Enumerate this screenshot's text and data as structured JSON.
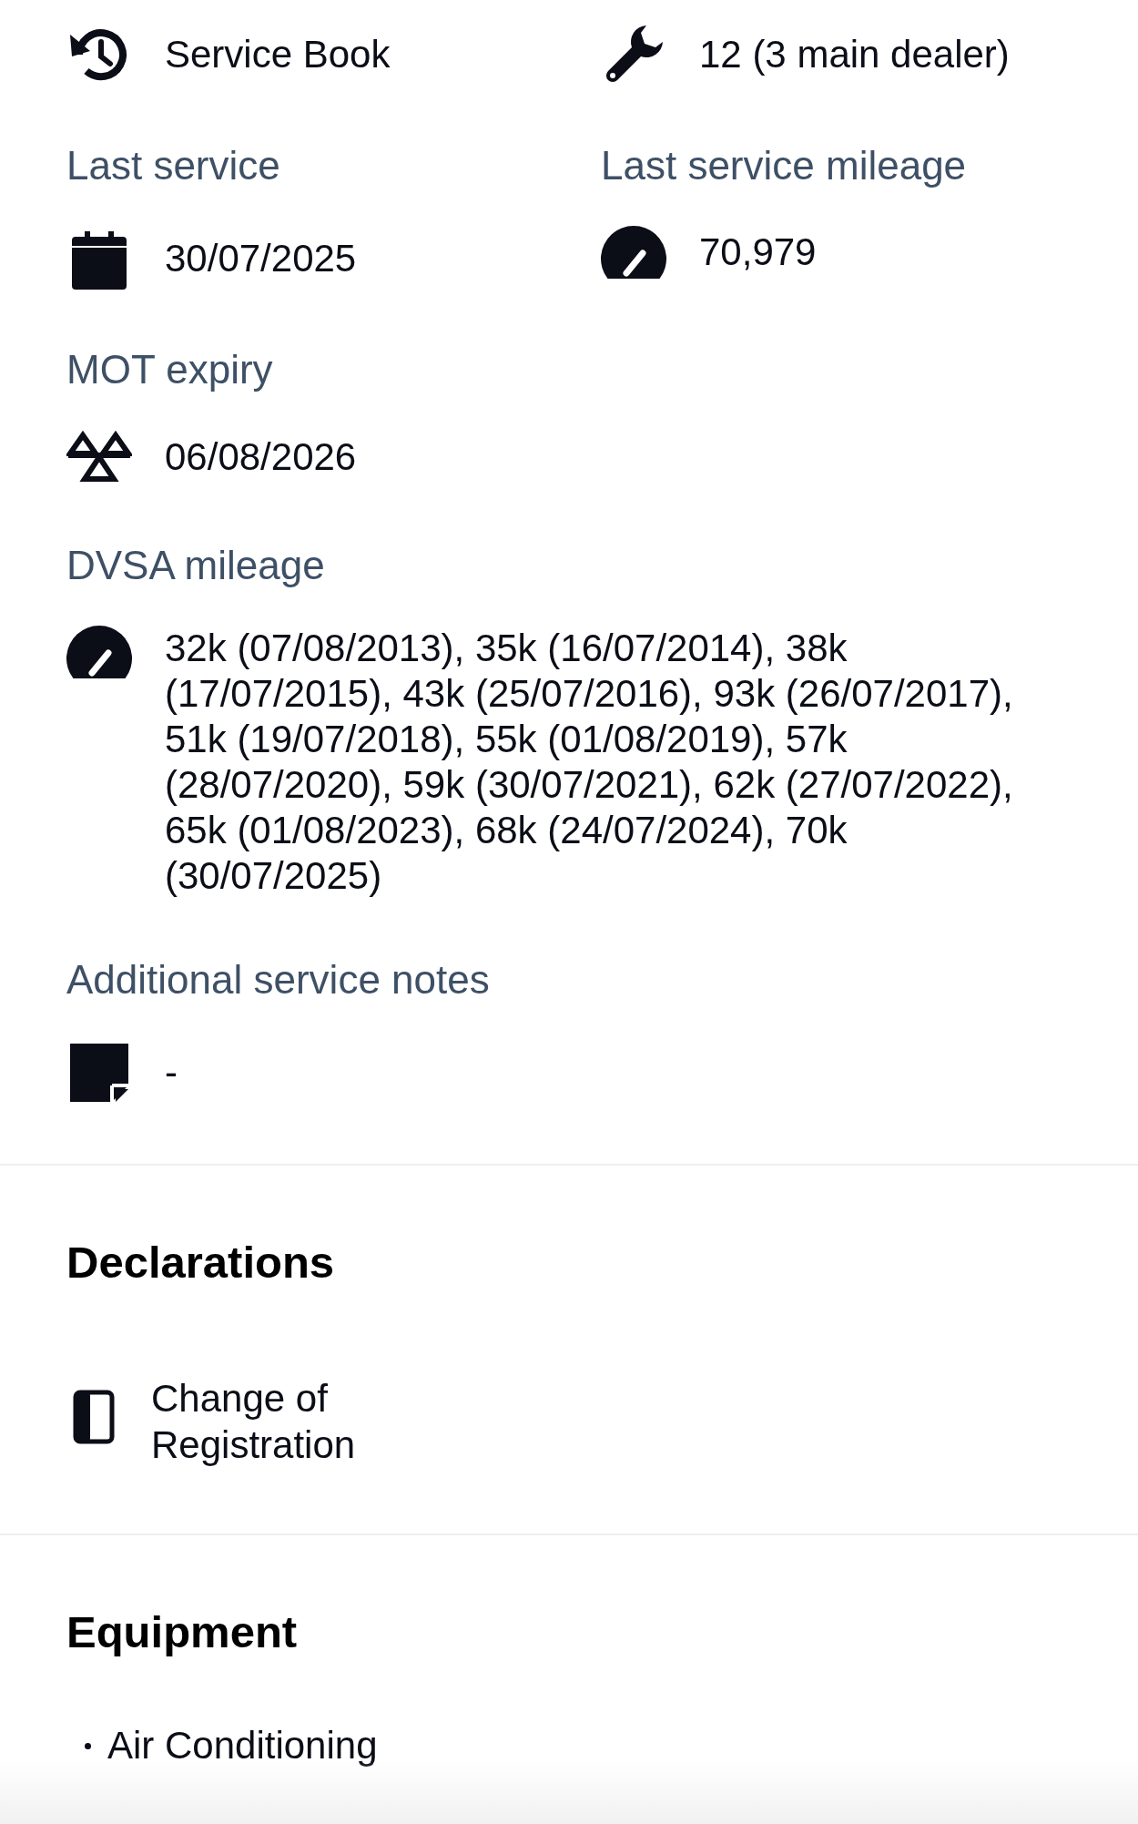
{
  "service_overview": [
    {
      "kind": "history",
      "value": "Service Book"
    },
    {
      "kind": "wrench",
      "value": "12 (3 main dealer)"
    },
    {
      "label": "Last service",
      "kind": "calendar",
      "value": "30/07/2025"
    },
    {
      "label": "Last service mileage",
      "kind": "gauge",
      "value": "70,979"
    }
  ],
  "service_details": [
    {
      "label": "MOT expiry",
      "kind": "mot",
      "value": "06/08/2026"
    },
    {
      "label": "DVSA mileage",
      "kind": "gauge",
      "value": "32k (07/08/2013), 35k (16/07/2014), 38k (17/07/2015), 43k (25/07/2016), 93k (26/07/2017), 51k (19/07/2018), 55k (01/08/2019), 57k (28/07/2020), 59k (30/07/2021), 62k (27/07/2022), 65k (01/08/2023), 68k (24/07/2024), 70k (30/07/2025)"
    },
    {
      "label": "Additional service notes",
      "kind": "note",
      "value": "-"
    }
  ],
  "declarations": {
    "title": "Declarations",
    "items": [
      {
        "kind": "panel",
        "text": "Change of Registration"
      }
    ]
  },
  "equipment": {
    "title": "Equipment",
    "items": [
      "Air Conditioning"
    ]
  }
}
